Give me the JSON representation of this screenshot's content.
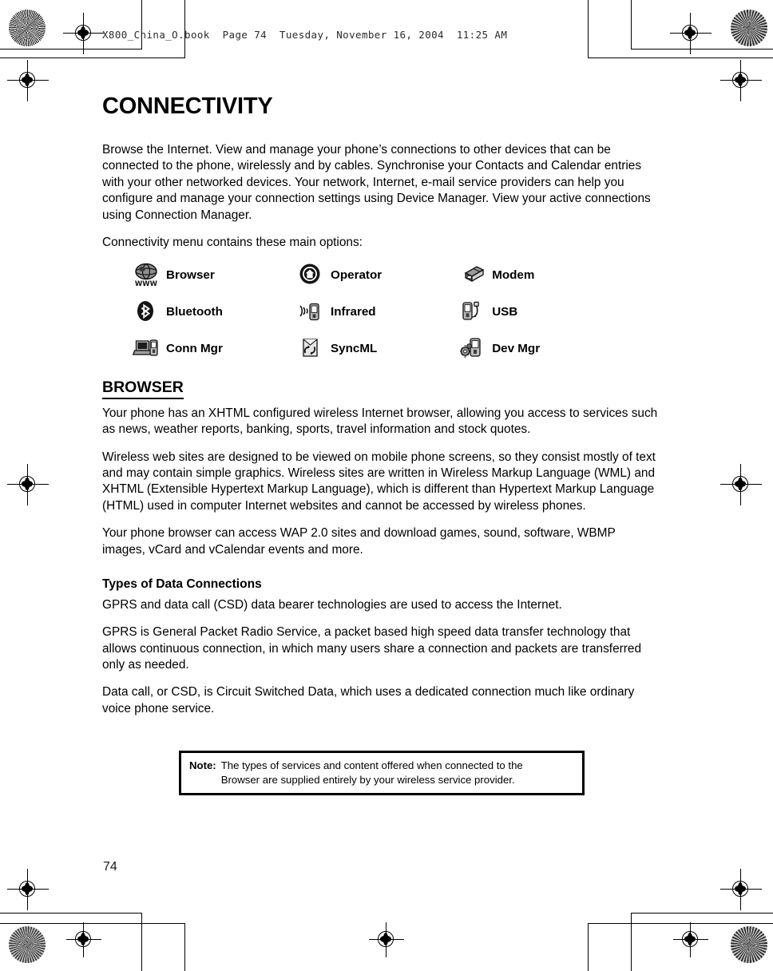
{
  "page": {
    "slug": "X800_China_O.book  Page 74  Tuesday, November 16, 2004  11:25 AM",
    "folio": "74",
    "ink": "#000000",
    "paper": "#ffffff"
  },
  "chapter": {
    "title": "CONNECTIVITY"
  },
  "intro": {
    "paragraph": "Browse the Internet. View and manage your phone’s connections to other devices that can be connected to the phone, wirelessly and by cables. Synchronise your Contacts and Calendar entries with your other networked devices. Your network, Internet, e-mail service providers can help you configure and manage your connection settings using Device Manager. View your active connections using Connection Manager.",
    "lead_in": "Connectivity menu contains these main options:"
  },
  "menu": {
    "rows": [
      [
        {
          "label": "Browser",
          "icon": "globe-www-icon"
        },
        {
          "label": "Operator",
          "icon": "operator-home-icon"
        },
        {
          "label": "Modem",
          "icon": "modem-icon"
        }
      ],
      [
        {
          "label": "Bluetooth",
          "icon": "bluetooth-icon"
        },
        {
          "label": "Infrared",
          "icon": "infrared-icon"
        },
        {
          "label": "USB",
          "icon": "usb-icon"
        }
      ],
      [
        {
          "label": "Conn Mgr",
          "icon": "connection-manager-icon"
        },
        {
          "label": "SyncML",
          "icon": "syncml-icon"
        },
        {
          "label": "Dev Mgr",
          "icon": "device-manager-icon"
        }
      ]
    ]
  },
  "browser": {
    "heading": "BROWSER",
    "p1": "Your phone has an XHTML configured wireless Internet browser, allowing you access to services such as news, weather reports, banking, sports, travel information and stock quotes.",
    "p2": "Wireless web sites are designed to be viewed on mobile phone screens, so they consist mostly of text and may contain simple graphics. Wireless sites are written in Wireless Markup Language (WML) and XHTML (Extensible Hypertext Markup Language), which is different than Hypertext Markup Language (HTML) used in computer Internet websites and cannot be accessed by wireless phones.",
    "p3": "Your phone browser can access WAP 2.0 sites and download games, sound, software, WBMP images, vCard and vCalendar events and more."
  },
  "data_connections": {
    "heading": "Types of Data Connections",
    "p1": "GPRS and data call (CSD) data bearer technologies are used to access the Internet.",
    "p2": "GPRS is General Packet Radio Service, a packet based high speed data transfer technology that allows continuous connection, in which many users share a connection and packets are transferred only as needed.",
    "p3": "Data call, or CSD, is Circuit Switched Data, which uses a dedicated connection much like ordinary voice phone service."
  },
  "note": {
    "label": "Note:",
    "line1": "The types of services and content offered when connected to the",
    "line2": "Browser are supplied entirely by your wireless service provider."
  }
}
